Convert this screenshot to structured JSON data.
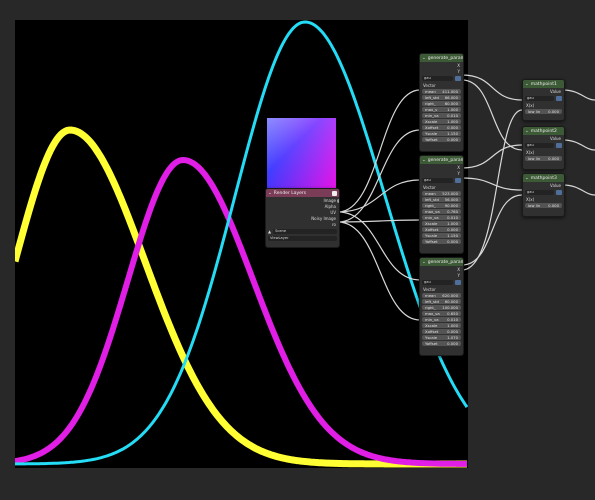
{
  "colors": {
    "yellow": "#ffff33",
    "magenta": "#e01ee6",
    "cyan": "#24dcf5",
    "node_header": "#3d5a36",
    "rl_header": "#7a3c56"
  },
  "gen_nodes": [
    {
      "title": "generate_parame",
      "dropdown": "gau",
      "fields": [
        {
          "k": "mean",
          "v": "411.000"
        },
        {
          "k": "left_std",
          "v": "66.000"
        },
        {
          "k": "right_",
          "v": "60.000"
        },
        {
          "k": "max_v",
          "v": "1.000"
        },
        {
          "k": "min_va",
          "v": "0.010"
        },
        {
          "k": "Xscale",
          "v": "1.000"
        },
        {
          "k": "Xoffset",
          "v": "0.000"
        },
        {
          "k": "Yscale",
          "v": "1.150"
        },
        {
          "k": "Yoffset",
          "v": "0.000"
        }
      ]
    },
    {
      "title": "generate_parame",
      "dropdown": "gau",
      "fields": [
        {
          "k": "mean",
          "v": "523.000"
        },
        {
          "k": "left_std",
          "v": "56.000"
        },
        {
          "k": "right_",
          "v": "90.000"
        },
        {
          "k": "max_va",
          "v": "0.760"
        },
        {
          "k": "min_va",
          "v": "0.010"
        },
        {
          "k": "Xscale",
          "v": "1.000"
        },
        {
          "k": "Xoffset",
          "v": "0.000"
        },
        {
          "k": "Yscale",
          "v": "1.150"
        },
        {
          "k": "Yoffset",
          "v": "0.000"
        }
      ]
    },
    {
      "title": "generate_parame",
      "dropdown": "gau",
      "fields": [
        {
          "k": "mean",
          "v": "620.000"
        },
        {
          "k": "left_std",
          "v": "60.000"
        },
        {
          "k": "right_",
          "v": "100.000"
        },
        {
          "k": "max_va",
          "v": "0.650"
        },
        {
          "k": "min_va",
          "v": "0.010"
        },
        {
          "k": "Xscale",
          "v": "1.000"
        },
        {
          "k": "Xoffset",
          "v": "0.000"
        },
        {
          "k": "Yscale",
          "v": "1.070"
        },
        {
          "k": "Yoffset",
          "v": "0.000"
        }
      ]
    }
  ],
  "math_nodes": [
    {
      "title": "mathpoint1",
      "dropdown": "gau",
      "out": "Value",
      "field": {
        "k": "low lin",
        "v": "0.000"
      }
    },
    {
      "title": "mathpoint2",
      "dropdown": "gau",
      "out": "Value",
      "field": {
        "k": "low lin",
        "v": "0.000"
      }
    },
    {
      "title": "mathpoint3",
      "dropdown": "gau",
      "out": "Value",
      "field": {
        "k": "low lin",
        "v": "0.000"
      }
    }
  ],
  "render_layers": {
    "title": "Render Layers",
    "outputs": [
      "Image",
      "Alpha",
      "UV",
      "Noisy Image",
      "ro"
    ],
    "scene": "Scene",
    "view_layer": "ViewLayer"
  },
  "labels": {
    "vector": "Vector",
    "x": "X",
    "y": "Y",
    "xin": "X(x)",
    "vector_out": "Vector"
  }
}
